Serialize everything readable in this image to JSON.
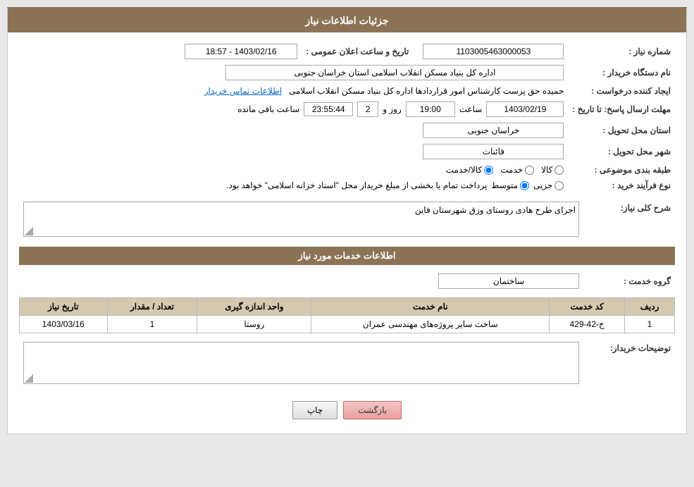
{
  "header": {
    "title": "جزئیات اطلاعات نیاز"
  },
  "fields": {
    "shomara_niaz_label": "شماره نیاز :",
    "shomara_niaz_value": "1103005463000053",
    "nam_dastgah_label": "نام دستگاه خریدار :",
    "nam_dastgah_value": "اداره کل بنیاد مسکن انقلاب اسلامی استان خراسان جنوبی",
    "ijad_konande_label": "ایجاد کننده درخواست :",
    "ijad_konande_value": "حمیده حق پرست کارشناس امور قراردادها اداره کل بنیاد مسکن انقلاب اسلامی",
    "ijad_konande_link": "اطلاعات تماس خریدار",
    "mohlat_label": "مهلت ارسال پاسخ: تا تاریخ :",
    "date_value": "1403/02/19",
    "saat_label": "ساعت",
    "saat_value": "19:00",
    "roz_label": "روز و",
    "roz_value": "2",
    "timer_value": "23:55:44",
    "baqi_mande_label": "ساعت باقی مانده",
    "ostan_label": "استان محل تحویل :",
    "ostan_value": "خراسان جنوبی",
    "shahr_label": "شهر محل تحویل :",
    "shahr_value": "قائنات",
    "tabaqe_label": "طبقه بندی موضوعی :",
    "tabaqe_kala": "کالا",
    "tabaqe_khedmat": "خدمت",
    "tabaqe_kala_khedmat": "کالا/خدمت",
    "noe_farayand_label": "نوع فرآیند خرید :",
    "noe_jozee": "جزیی",
    "noe_motavaset": "متوسط",
    "noe_description": "پرداخت تمام یا بخشی از مبلغ خریداز محل \"اسناد خزانه اسلامی\" خواهد بود.",
    "sharh_label": "شرح کلی نیاز:",
    "sharh_value": "اجرای طرح هادی روستای وزق شهرستان قاین",
    "services_section": "اطلاعات خدمات مورد نیاز",
    "group_service_label": "گروه خدمت :",
    "group_service_value": "ساختمان",
    "table_headers": {
      "radif": "ردیف",
      "kod_khedmat": "کد خدمت",
      "nam_khedmat": "نام خدمت",
      "vahed_andazegiri": "واحد اندازه گیری",
      "tedad_megdar": "تعداد / مقدار",
      "tarikh_niaz": "تاریخ نیاز"
    },
    "table_rows": [
      {
        "radif": "1",
        "kod": "ج-42-429",
        "nam": "ساخت سایر پروژه‌های مهندسی عمران",
        "vahed": "روستا",
        "tedad": "1",
        "tarikh": "1403/03/16"
      }
    ],
    "toseeh_label": "توضیحات خریدار:",
    "toseeh_value": "",
    "btn_print": "چاپ",
    "btn_back": "بازگشت",
    "tarikh_elan_label": "تاریخ و ساعت اعلان عمومی :",
    "tarikh_elan_value": "1403/02/16 - 18:57"
  }
}
